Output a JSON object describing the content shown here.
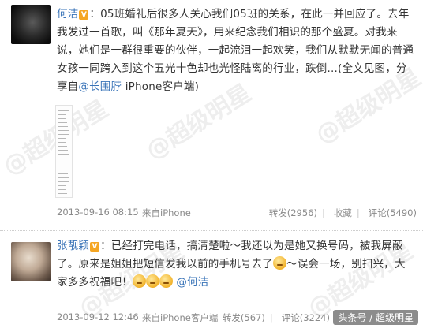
{
  "posts": [
    {
      "author": "何洁",
      "badge": "V",
      "text_1": "：05班婚礼后很多人关心我们05班的关系，在此一并回应了。去年我发过一首歌，叫《那年夏天》，用来纪念我们相识的那个盛夏。对我来说，她们是一群很重要的伙伴，一起流泪一起欢笑，我们从默默无闻的普通女孩一同跨入到这个五光十色却也光怪陆离的行业，跌倒...(全文见图，分享自",
      "mention": "@长围脖",
      "client": " iPhone客户端)",
      "time": "2013-09-16 08:15",
      "source": "来自iPhone",
      "repost": "转发(2956)",
      "favorite": "收藏",
      "comment": "评论(5490)"
    },
    {
      "author": "张靓颖",
      "badge": "V",
      "text_1": "：已经打完电话，搞清楚啦～我还以为是她又换号码，被我屏蔽了。原来是姐姐把短信发我以前的手机号去了",
      "text_2": "～误会一场，别扫兴，大家多多祝福吧！",
      "mention": "@何洁",
      "time": "2013-09-12 12:46",
      "source": "来自iPhone客户端",
      "repost": "转发(567)",
      "comment": "评论(3224)"
    }
  ],
  "icons": {
    "avatar_1": "dark-portrait-avatar",
    "avatar_2": "selfie-avatar",
    "emoticon": "crying-face-emoticon",
    "long_image": "long-text-image-thumbnail"
  },
  "colors": {
    "link": "#3a74b8",
    "vip_badge": "#f5a623",
    "meta_text": "#8a8a8a"
  },
  "watermark_text": "@超级明星",
  "footer_mark": "头条号 / 超级明星"
}
